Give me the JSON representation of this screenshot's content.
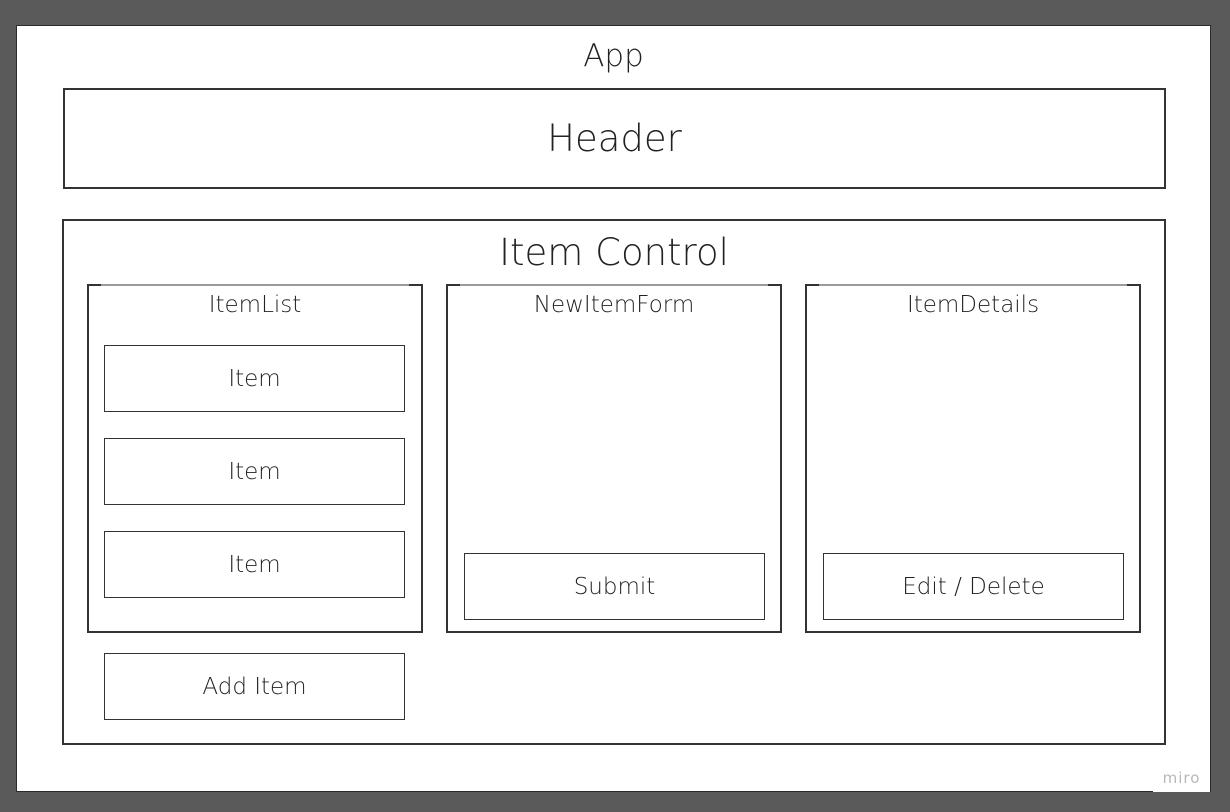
{
  "app": {
    "label": "App"
  },
  "header": {
    "label": "Header"
  },
  "item_control": {
    "label": "Item Control",
    "item_list": {
      "label": "ItemList",
      "items": [
        "Item",
        "Item",
        "Item"
      ]
    },
    "new_item_form": {
      "label": "NewItemForm",
      "button_label": "Submit"
    },
    "item_details": {
      "label": "ItemDetails",
      "button_label": "Edit / Delete"
    },
    "add_item_label": "Add Item"
  },
  "watermark": "miro",
  "colors": {
    "outer_background": "#5a5a5a",
    "canvas": "#ffffff",
    "stroke": "#333333"
  }
}
